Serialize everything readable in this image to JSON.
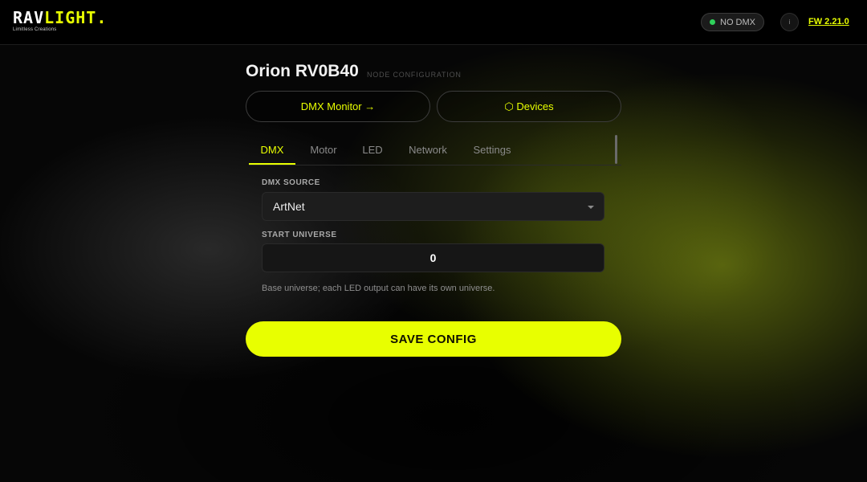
{
  "header": {
    "logo_part1": "RAV",
    "logo_part2": "LIGHT.",
    "logo_tagline": "Limitless Creations",
    "dmx_status": "NO DMX",
    "info_label": "i",
    "firmware": "FW 2.21.0"
  },
  "page": {
    "title": "Orion RV0B40",
    "subtitle": "NODE CONFIGURATION"
  },
  "nav": {
    "dmx_monitor": "DMX Monitor →",
    "devices": "⬡ Devices"
  },
  "tabs": [
    {
      "label": "DMX",
      "active": true
    },
    {
      "label": "Motor",
      "active": false
    },
    {
      "label": "LED",
      "active": false
    },
    {
      "label": "Network",
      "active": false
    },
    {
      "label": "Settings",
      "active": false
    }
  ],
  "form": {
    "source_label": "DMX SOURCE",
    "source_value": "ArtNet",
    "universe_label": "START UNIVERSE",
    "universe_value": "0",
    "hint": "Base universe; each LED output can have its own universe."
  },
  "save_label": "SAVE CONFIG",
  "colors": {
    "accent": "#e8ff00",
    "status_dot": "#2fd15b",
    "background": "#060606"
  }
}
